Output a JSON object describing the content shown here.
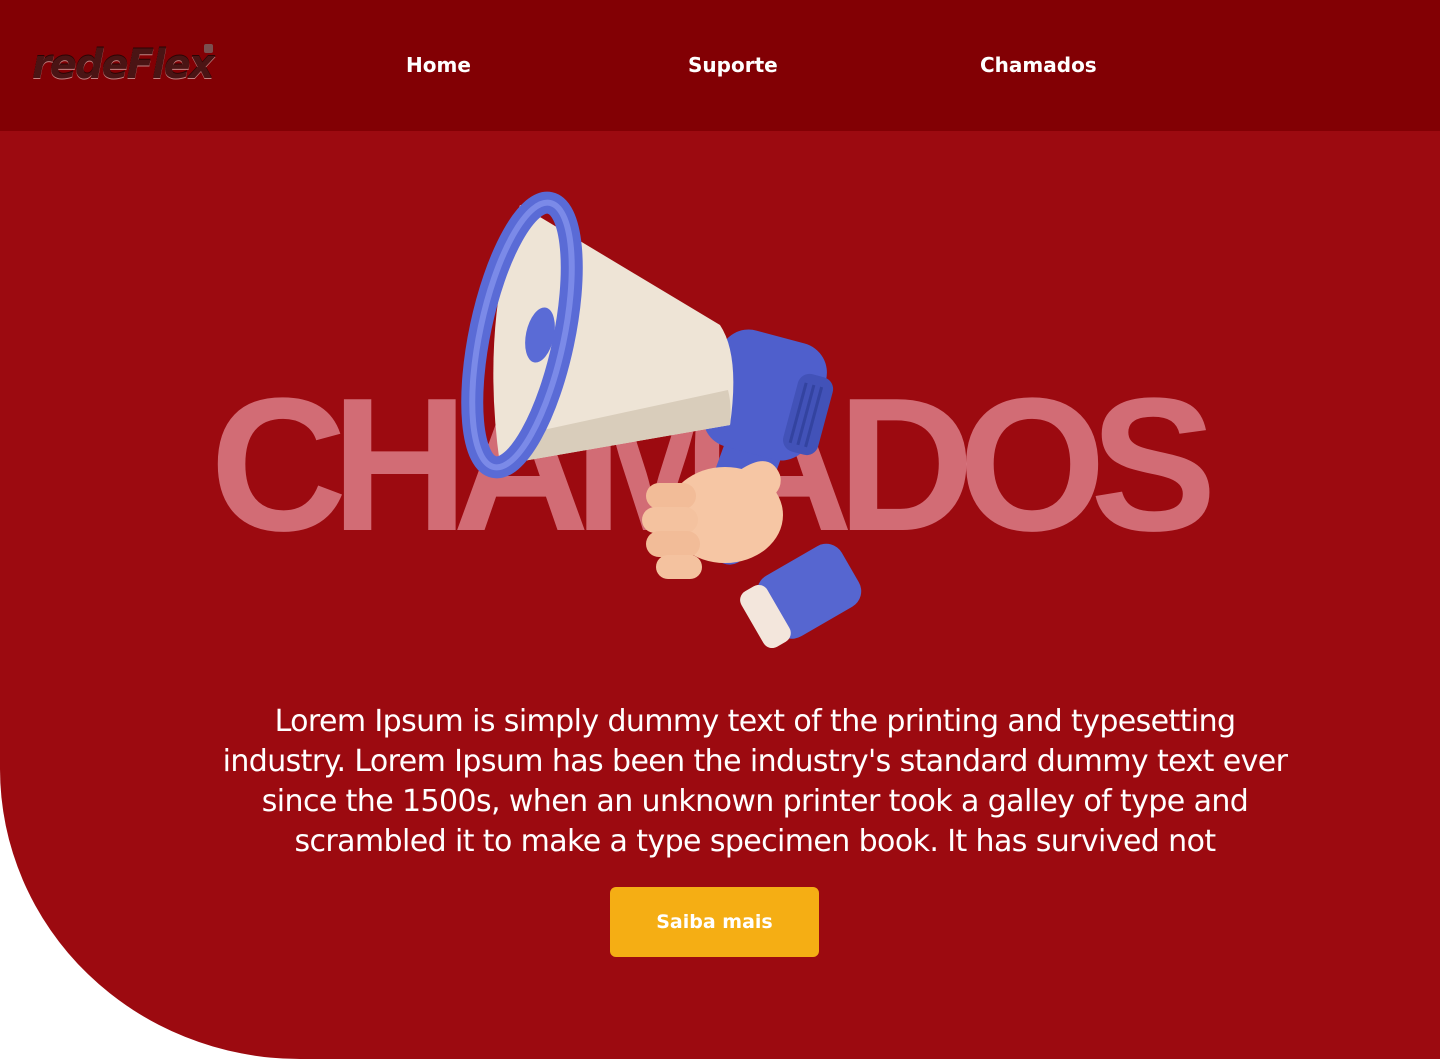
{
  "brand": {
    "logo_text": "redeFlex"
  },
  "nav": {
    "items": [
      {
        "label": "Home"
      },
      {
        "label": "Suporte"
      },
      {
        "label": "Chamados"
      }
    ]
  },
  "hero": {
    "title": "CHAMADOS",
    "illustration": "megaphone-in-hand-icon",
    "description": "Lorem Ipsum is simply dummy text of the printing and typesetting industry. Lorem Ipsum has been the industry's standard dummy text ever since the 1500s, when an unknown printer took a galley of type and scrambled it to make a type specimen book. It has survived not",
    "cta_label": "Saiba mais"
  },
  "colors": {
    "navbar": "#820004",
    "hero_background": "#9c0a10",
    "cta": "#f5ae14",
    "megaphone_blue": "#5a6bd6",
    "megaphone_cream": "#efe6d8"
  }
}
